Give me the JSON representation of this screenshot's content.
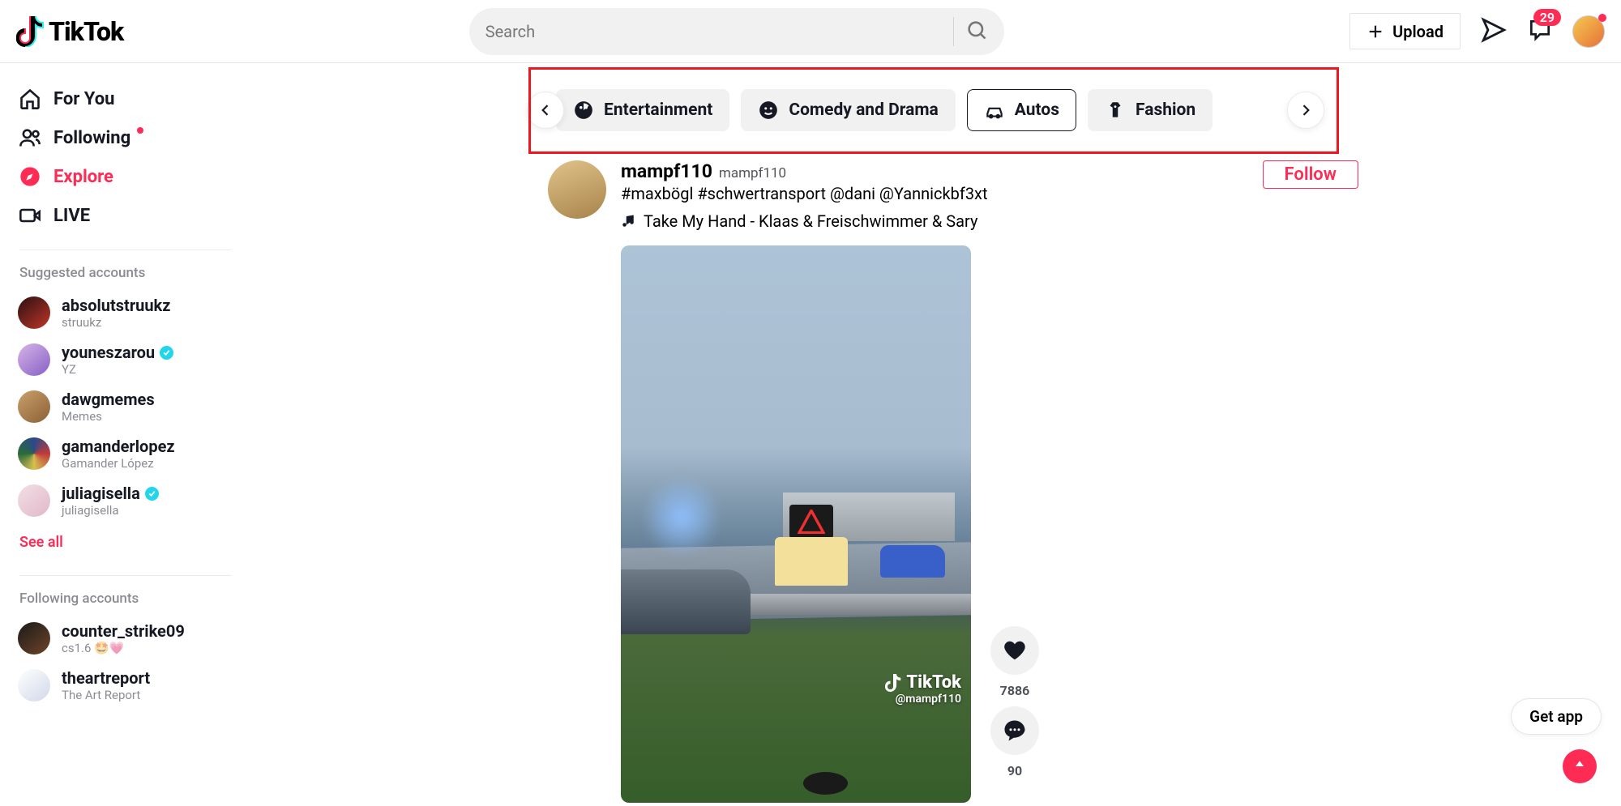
{
  "header": {
    "brand": "TikTok",
    "search_placeholder": "Search",
    "upload_label": "Upload",
    "inbox_count": "29"
  },
  "sidebar": {
    "nav": {
      "foryou": "For You",
      "following": "Following",
      "explore": "Explore",
      "live": "LIVE"
    },
    "suggested_title": "Suggested accounts",
    "suggested": [
      {
        "name": "absolutstruukz",
        "sub": "struukz",
        "verified": false,
        "avbg": "linear-gradient(140deg,#2a1010,#c0362a)"
      },
      {
        "name": "youneszarou",
        "sub": "YZ",
        "verified": true,
        "avbg": "linear-gradient(140deg,#d8b4e8,#8560c4)"
      },
      {
        "name": "dawgmemes",
        "sub": "Memes",
        "verified": false,
        "avbg": "linear-gradient(140deg,#caa06a,#8a6038)"
      },
      {
        "name": "gamanderlopez",
        "sub": "Gamander López",
        "verified": false,
        "avbg": "conic-gradient(#2a4a8a,#c03a3a,#d6c050,#2a6a3a,#2a4a8a)"
      },
      {
        "name": "juliagisella",
        "sub": "juliagisella",
        "verified": true,
        "avbg": "linear-gradient(140deg,#f2dfe6,#e0b8c8)"
      }
    ],
    "see_all": "See all",
    "following_title": "Following accounts",
    "following_list": [
      {
        "name": "counter_strike09",
        "sub": "cs1.6 🤩💗",
        "avbg": "linear-gradient(140deg,#1a1a1a,#6e4428)"
      },
      {
        "name": "theartreport",
        "sub": "The Art Report",
        "avbg": "linear-gradient(140deg,#ffffff,#d0d8e8)"
      }
    ]
  },
  "categories": {
    "items": [
      {
        "label": "Entertainment",
        "active": false
      },
      {
        "label": "Comedy and Drama",
        "active": false
      },
      {
        "label": "Autos",
        "active": true
      },
      {
        "label": "Fashion",
        "active": false
      }
    ]
  },
  "post": {
    "author": "mampf110",
    "author_sub": "mampf110",
    "caption": "#maxbögl #schwertransport @dani @Yannickbf3xt",
    "music": "Take My Hand - Klaas & Freischwimmer & Sary",
    "follow": "Follow",
    "watermark_user": "@mampf110",
    "likes": "7886",
    "comments": "90"
  },
  "floating": {
    "get_app": "Get app"
  }
}
